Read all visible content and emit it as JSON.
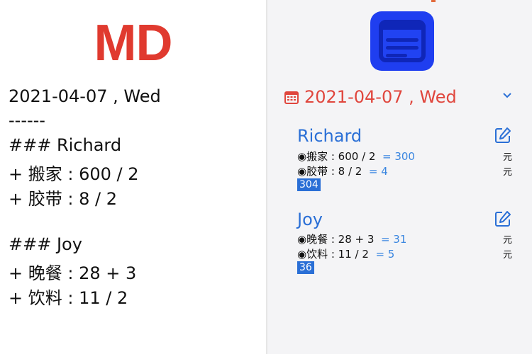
{
  "left": {
    "logo": "MD",
    "lines": [
      "2021-04-07 , Wed",
      "------",
      "### Richard",
      "+ 搬家 : 600 / 2",
      "+ 胶带 : 8 / 2",
      "### Joy",
      "+ 晚餐 : 28 + 3",
      "+ 饮料 : 11 / 2"
    ]
  },
  "right": {
    "date": "2021-04-07 , Wed",
    "people": [
      {
        "name": "Richard",
        "items": [
          {
            "label": "◉搬家 : 600 / 2",
            "result": "= 300",
            "unit": "元"
          },
          {
            "label": "◉胶带 : 8 / 2",
            "result": "= 4",
            "unit": "元"
          }
        ],
        "total": "304"
      },
      {
        "name": "Joy",
        "items": [
          {
            "label": "◉晚餐 : 28 + 3",
            "result": "= 31",
            "unit": "元"
          },
          {
            "label": "◉饮料 : 11 / 2",
            "result": "= 5",
            "unit": "元"
          }
        ],
        "total": "36"
      }
    ]
  },
  "colors": {
    "logo_red": "#e03a2f",
    "date_red": "#e0463d",
    "blue": "#2a6fd6",
    "app_blue": "#1f3ef0"
  },
  "icons": [
    "app-icon",
    "calendar-icon",
    "chevron-down-icon",
    "edit-icon"
  ]
}
